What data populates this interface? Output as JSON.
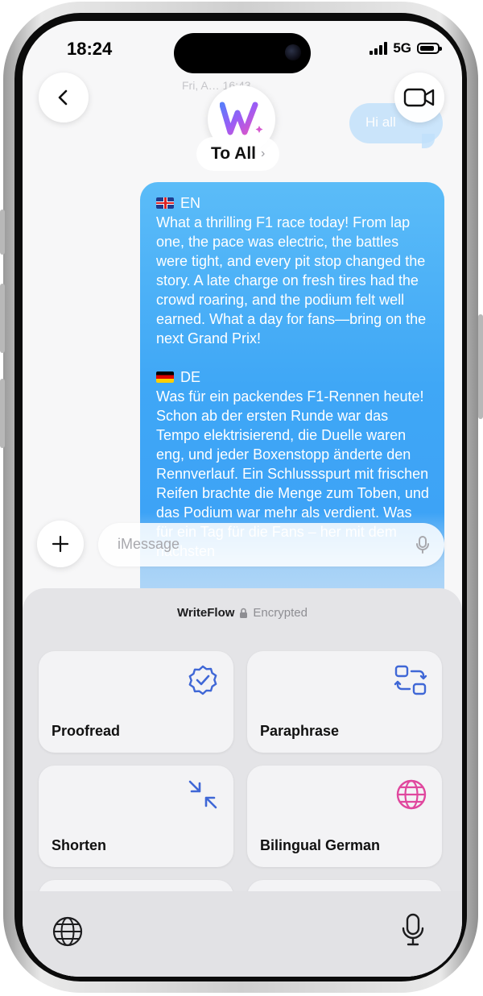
{
  "status_bar": {
    "time": "18:24",
    "network": "5G"
  },
  "conversation": {
    "date_line": "Fri, A… 16:43",
    "recipient": "To All",
    "incoming_preview": "Hi all"
  },
  "message": {
    "en_label": "EN",
    "en_text": "What a thrilling F1 race today! From lap one, the pace was electric, the battles were tight, and every pit stop changed the story. A late charge on fresh tires had the crowd roaring, and the podium felt well earned. What a day for fans—bring on the next Grand Prix!",
    "de_label": "DE",
    "de_text": "Was für ein packendes F1-Rennen heute! Schon ab der ersten Runde war das Tempo elektrisierend, die Duelle waren eng, und jeder Boxenstopp änderte den Rennverlauf. Ein Schlussspurt mit frischen Reifen brachte die Menge zum Toben, und das Podium war mehr als verdient. Was für ein Tag für die Fans – her mit dem nächsten"
  },
  "input": {
    "placeholder": "iMessage"
  },
  "keyboard_panel": {
    "brand": "WriteFlow",
    "status": "Encrypted",
    "actions": [
      {
        "label": "Proofread",
        "icon": "verified-badge-icon"
      },
      {
        "label": "Paraphrase",
        "icon": "swap-icon"
      },
      {
        "label": "Shorten",
        "icon": "compress-arrows-icon"
      },
      {
        "label": "Bilingual German",
        "icon": "globe-icon"
      }
    ]
  },
  "colors": {
    "bubble": "#3b9ff5",
    "accent": "#3f67d6",
    "bilingual": "#e0479e"
  }
}
